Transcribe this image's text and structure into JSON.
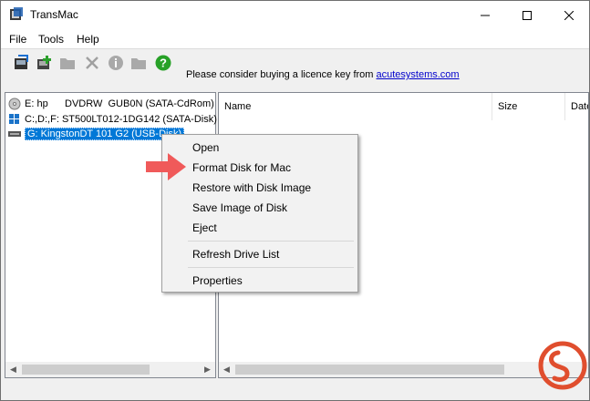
{
  "window": {
    "title": "TransMac",
    "minimize_glyph": "—",
    "maximize_glyph": "☐",
    "close_glyph": "✕"
  },
  "menubar": {
    "items": [
      "File",
      "Tools",
      "Help"
    ]
  },
  "toolbar": {
    "buttons": [
      {
        "icon": "open-disk-icon",
        "enabled": true
      },
      {
        "icon": "new-image-icon",
        "enabled": true
      },
      {
        "icon": "folder-icon",
        "enabled": false
      },
      {
        "icon": "delete-icon",
        "enabled": false
      },
      {
        "icon": "info-icon",
        "enabled": false
      },
      {
        "icon": "new-folder-icon",
        "enabled": false
      },
      {
        "icon": "help-icon",
        "enabled": true
      }
    ],
    "notice_text": "Please consider buying a licence key from ",
    "notice_link": "acutesystems.com"
  },
  "drives": [
    {
      "label": "E: hp      DVDRW  GUB0N (SATA-CdRom)",
      "icon": "cdrom-drive-icon",
      "selected": false
    },
    {
      "label": "C:,D:,F: ST500LT012-1DG142 (SATA-Disk)",
      "icon": "windows-drive-icon",
      "selected": false
    },
    {
      "label": "G: KingstonDT 101 G2 (USB-Disk)",
      "icon": "usb-drive-icon",
      "selected": true
    }
  ],
  "file_list": {
    "columns": [
      "Name",
      "Size",
      "Date"
    ]
  },
  "context_menu": {
    "items": [
      {
        "label": "Open",
        "highlighted": false
      },
      {
        "label": "Format Disk for Mac",
        "highlighted": true
      },
      {
        "label": "Restore with Disk Image",
        "highlighted": false
      },
      {
        "label": "Save Image of Disk",
        "highlighted": false
      },
      {
        "label": "Eject",
        "highlighted": false
      },
      {
        "label": "Refresh Drive List",
        "highlighted": false
      },
      {
        "label": "Properties",
        "highlighted": false
      }
    ]
  },
  "colors": {
    "selection": "#0078d7",
    "annotation_arrow": "#f05a5a",
    "watermark": "#e04e2e",
    "help_icon": "#27a127"
  }
}
